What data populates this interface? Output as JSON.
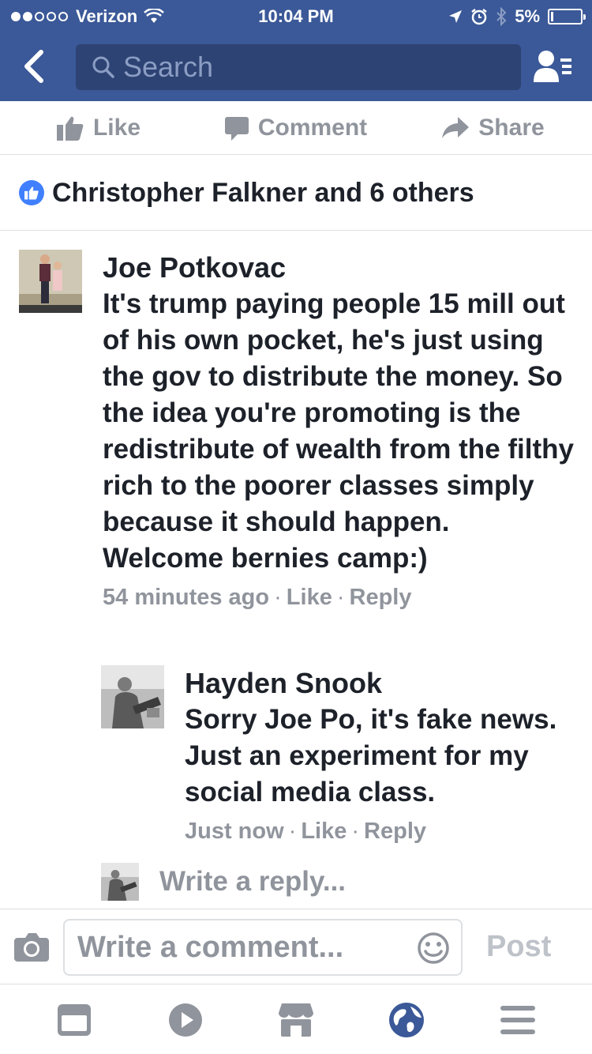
{
  "status_bar": {
    "carrier": "Verizon",
    "time": "10:04 PM",
    "battery": "5%",
    "signal_bars": 2,
    "battery_level": 0.05
  },
  "header": {
    "search_placeholder": "Search",
    "icons": [
      "back-chevron-icon",
      "search-icon",
      "friend-requests-icon"
    ],
    "bar_color": "#3b5998"
  },
  "post_actions": {
    "like": "Like",
    "comment": "Comment",
    "share": "Share"
  },
  "likes_summary": "Christopher Falkner and 6 others",
  "comments": [
    {
      "author": "Joe Potkovac",
      "text": "It's trump paying people 15 mill out of his own pocket, he's just using the gov to distribute the money. So the idea you're promoting is the redistribute of wealth from the filthy rich to the poorer classes simply because it should happen. Welcome bernies camp:)",
      "time": "54 minutes ago",
      "like": "Like",
      "reply": "Reply",
      "replies": [
        {
          "author": "Hayden Snook",
          "text": "Sorry Joe Po, it's fake news. Just an experiment for my social media class.",
          "time": "Just now",
          "like": "Like",
          "reply": "Reply"
        }
      ]
    }
  ],
  "reply_placeholder": "Write a reply...",
  "composer": {
    "placeholder": "Write a comment...",
    "post": "Post"
  },
  "tab_bar": {
    "tabs": [
      "news-feed-icon",
      "video-icon",
      "marketplace-icon",
      "notifications-globe-icon",
      "menu-icon"
    ],
    "active_index": 3,
    "active_color": "#3b5998",
    "inactive_color": "#90949c"
  }
}
